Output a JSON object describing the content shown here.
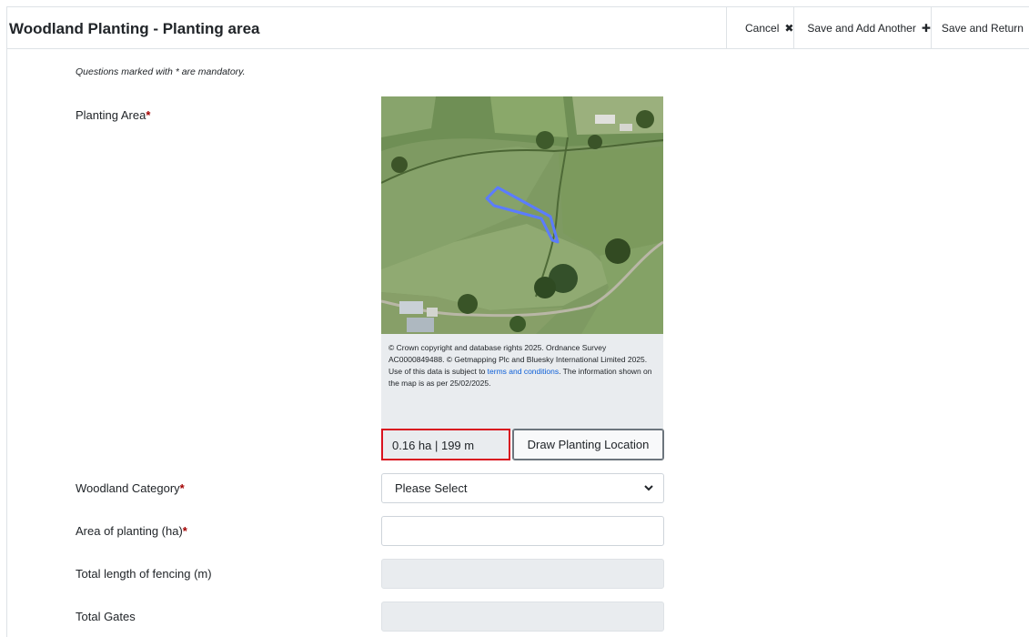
{
  "header": {
    "title": "Woodland Planting - Planting area",
    "cancel_label": "Cancel",
    "save_add_label": "Save and Add Another",
    "save_return_label": "Save and Return"
  },
  "form": {
    "mandatory_note": "Questions marked with * are mandatory.",
    "planting_area_label": "Planting Area",
    "map": {
      "attribution_text": "© Crown copyright and database rights 2025. Ordnance Survey AC0000849488. © Getmapping Plc and Bluesky International Limited 2025. Use of this data is subject to ",
      "attribution_link": "terms and conditions",
      "attribution_suffix": ". The information shown on the map is as per 25/02/2025."
    },
    "area_readout": "0.16 ha | 199 m",
    "draw_button_label": "Draw Planting Location",
    "woodland_category_label": "Woodland Category",
    "woodland_category_value": "Please Select",
    "area_of_planting_label": "Area of planting (ha)",
    "area_of_planting_value": "",
    "fencing_label": "Total length of fencing (m)",
    "fencing_value": "",
    "gates_label": "Total Gates",
    "gates_value": "",
    "required_marker": "*"
  },
  "colors": {
    "required": "#a30000",
    "highlight_border": "#d9121f",
    "polygon_stroke": "#5b7cff",
    "link": "#0b5ed7"
  }
}
